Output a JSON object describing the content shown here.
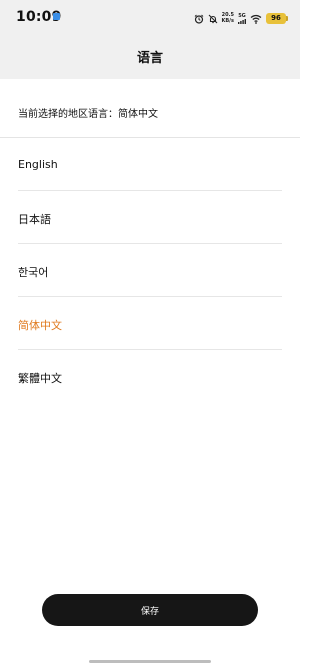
{
  "status_bar": {
    "time": "10:09",
    "net_speed_value": "20.5",
    "net_speed_unit": "KB/s",
    "signal_label": "5G",
    "battery": "96"
  },
  "header": {
    "title": "语言"
  },
  "current_region": {
    "text": "当前选择的地区语言：简体中文"
  },
  "languages": [
    {
      "label": "English",
      "selected": false
    },
    {
      "label": "日本語",
      "selected": false
    },
    {
      "label": "한국어",
      "selected": false
    },
    {
      "label": "简体中文",
      "selected": true
    },
    {
      "label": "繁體中文",
      "selected": false
    }
  ],
  "save_button": {
    "label": "保存"
  },
  "colors": {
    "accent": "#e07a1f",
    "button_bg": "#161616",
    "header_bg": "#f0f0f0",
    "battery": "#e8c13a"
  }
}
